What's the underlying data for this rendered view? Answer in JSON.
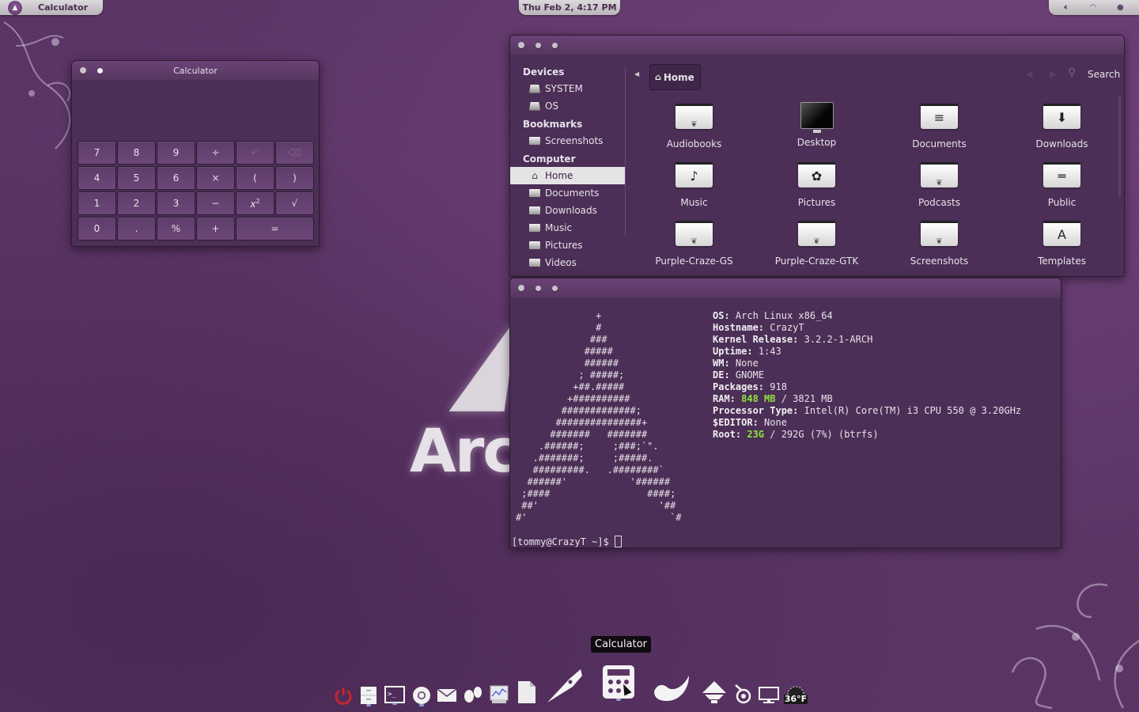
{
  "top_panel": {
    "app_name": "Calculator",
    "clock": "Thu Feb  2, 4:17 PM",
    "status_icons": [
      "volume-icon",
      "wifi-icon",
      "chat-icon"
    ]
  },
  "wallpaper": {
    "logo_text": "Arc"
  },
  "calculator": {
    "title": "Calculator",
    "display_value": "",
    "keys": [
      {
        "label": "7"
      },
      {
        "label": "8"
      },
      {
        "label": "9"
      },
      {
        "label": "÷"
      },
      {
        "label": "↶",
        "icon": "undo-icon",
        "disabled": true
      },
      {
        "label": "⌫",
        "icon": "backspace-icon",
        "disabled": true
      },
      {
        "label": "4"
      },
      {
        "label": "5"
      },
      {
        "label": "6"
      },
      {
        "label": "×"
      },
      {
        "label": "("
      },
      {
        "label": ")"
      },
      {
        "label": "1"
      },
      {
        "label": "2"
      },
      {
        "label": "3"
      },
      {
        "label": "−"
      },
      {
        "label": "x²"
      },
      {
        "label": "√"
      },
      {
        "label": "0"
      },
      {
        "label": "."
      },
      {
        "label": "%"
      },
      {
        "label": "+"
      },
      {
        "label": "=",
        "wide": true
      }
    ]
  },
  "file_manager": {
    "sidebar": {
      "sections": [
        {
          "heading": "Devices",
          "items": [
            {
              "label": "SYSTEM",
              "icon": "drive-icon"
            },
            {
              "label": "OS",
              "icon": "drive-icon"
            }
          ]
        },
        {
          "heading": "Bookmarks",
          "items": [
            {
              "label": "Screenshots",
              "icon": "folder-icon"
            }
          ]
        },
        {
          "heading": "Computer",
          "items": [
            {
              "label": "Home",
              "icon": "home-icon",
              "active": true
            },
            {
              "label": "Documents",
              "icon": "folder-icon"
            },
            {
              "label": "Downloads",
              "icon": "folder-icon"
            },
            {
              "label": "Music",
              "icon": "folder-icon"
            },
            {
              "label": "Pictures",
              "icon": "folder-icon"
            },
            {
              "label": "Videos",
              "icon": "folder-icon"
            }
          ]
        }
      ]
    },
    "breadcrumb": "Home",
    "search_label": "Search",
    "items": [
      {
        "label": "Audiobooks",
        "icon": "folder-icon"
      },
      {
        "label": "Desktop",
        "icon": "desktop-icon"
      },
      {
        "label": "Documents",
        "icon": "folder-documents-icon"
      },
      {
        "label": "Downloads",
        "icon": "folder-download-icon"
      },
      {
        "label": "Music",
        "icon": "folder-music-icon"
      },
      {
        "label": "Pictures",
        "icon": "folder-pictures-icon"
      },
      {
        "label": "Podcasts",
        "icon": "folder-icon"
      },
      {
        "label": "Public",
        "icon": "folder-public-icon"
      },
      {
        "label": "Purple-Craze-GS",
        "icon": "folder-icon"
      },
      {
        "label": "Purple-Craze-GTK",
        "icon": "folder-icon"
      },
      {
        "label": "Screenshots",
        "icon": "folder-icon"
      },
      {
        "label": "Templates",
        "icon": "folder-templates-icon"
      }
    ]
  },
  "terminal": {
    "ascii_art": [
      "              +",
      "              #",
      "             ###",
      "            #####",
      "            ######",
      "           ; #####;",
      "          +##.#####",
      "         +##########",
      "        #############;",
      "       ###############+",
      "      #######   #######",
      "    .######;     ;###;`\".",
      "   .#######;     ;#####.",
      "   #########.   .########`",
      "  ######'           '######",
      " ;####                 ####;",
      " ##'                     '##",
      "#'                         `#"
    ],
    "info": [
      {
        "key": "OS:",
        "value": "Arch Linux x86_64"
      },
      {
        "key": "Hostname:",
        "value": "CrazyT"
      },
      {
        "key": "Kernel Release:",
        "value": "3.2.2-1-ARCH"
      },
      {
        "key": "Uptime:",
        "value": "1:43"
      },
      {
        "key": "WM:",
        "value": "None"
      },
      {
        "key": "DE:",
        "value": "GNOME"
      },
      {
        "key": "Packages:",
        "value": "918"
      },
      {
        "key": "RAM:",
        "highlight": "848 MB",
        "value": "/ 3821 MB"
      },
      {
        "key": "Processor Type:",
        "value": "Intel(R) Core(TM) i3 CPU 550 @ 3.20GHz"
      },
      {
        "key": "$EDITOR:",
        "value": "None"
      },
      {
        "key": "Root:",
        "highlight": "23G",
        "value": "/ 292G (7%) (btrfs)"
      }
    ],
    "prompt": "[tommy@CrazyT ~]$ ",
    "highlight_color": "#8ee33a"
  },
  "dock": {
    "tooltip": "Calculator",
    "weather": "36°F",
    "items": [
      {
        "name": "power-icon"
      },
      {
        "name": "file-cabinet-icon"
      },
      {
        "name": "terminal-icon"
      },
      {
        "name": "chrome-icon"
      },
      {
        "name": "mail-icon"
      },
      {
        "name": "footprints-icon"
      },
      {
        "name": "system-monitor-icon"
      },
      {
        "name": "libreoffice-icon"
      },
      {
        "name": "pen-nib-icon"
      },
      {
        "name": "calculator-icon"
      },
      {
        "name": "gimp-icon"
      },
      {
        "name": "inkscape-icon"
      },
      {
        "name": "blender-icon"
      },
      {
        "name": "display-icon"
      },
      {
        "name": "weather-icon"
      }
    ]
  }
}
